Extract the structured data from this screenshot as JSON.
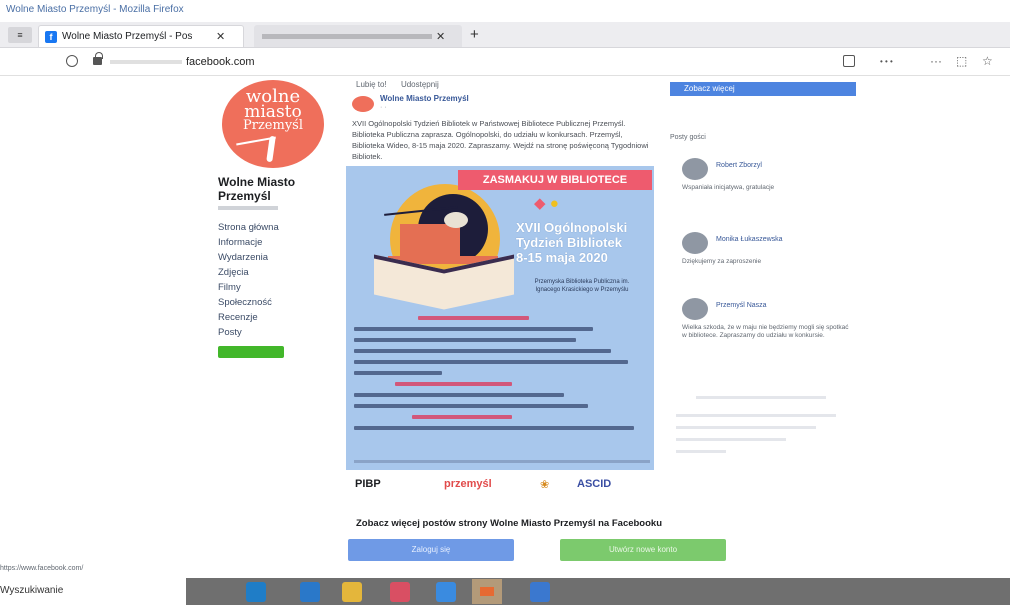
{
  "window": {
    "title": "Wolne Miasto Przemyśl - Mozilla Firefox"
  },
  "tabs": [
    {
      "label": "Wolne Miasto Przemyśl - Pos",
      "close": "✕"
    },
    {
      "label": "",
      "close": "✕"
    }
  ],
  "navbar": {
    "url_host": "facebook.com",
    "more": "···",
    "page_actions": "⋯"
  },
  "page": {
    "logo": {
      "line1": "wolne",
      "line2": "miasto",
      "line3": "Przemyśl"
    },
    "name": "Wolne Miasto Przemyśl",
    "nav": [
      "Strona główna",
      "Informacje",
      "Wydarzenia",
      "Zdjęcia",
      "Filmy",
      "Społeczność",
      "Recenzje",
      "Posty"
    ]
  },
  "post": {
    "tabs": [
      "Lubię to!",
      "Udostępnij"
    ],
    "author": "Wolne Miasto Przemyśl",
    "time": "· ·",
    "text": "XVII Ogólnopolski Tydzień Bibliotek w Państwowej Bibliotece Publicznej Przemyśl. Biblioteka Publiczna zaprasza. Ogólnopolski, do udziału w konkursach. Przemyśl, Biblioteka Wideo, 8-15 maja 2020. Zapraszamy. Wejdź na stronę poświęconą Tygodniowi Bibliotek."
  },
  "poster": {
    "banner": "ZASMAKUJ W BIBLIOTECE",
    "title_line1": "XVII Ogólnopolski",
    "title_line2": "Tydzień Bibliotek",
    "dates": "8-15 maja 2020",
    "org": "Przemyska Biblioteka Publiczna im. Ignacego Krasickiego w Przemyślu"
  },
  "logos": {
    "pizp": "PIBP",
    "mid": "przemyśl",
    "tree": "❀",
    "last": "ASCID"
  },
  "right": {
    "cta": "Zobacz więcej",
    "heading": "Posty gości",
    "entries": [
      {
        "name": "Robert Zborzyl",
        "text": "Wspaniała inicjatywa, gratulacje"
      },
      {
        "name": "Monika Łukaszewska",
        "text": "Dziękujemy za zaproszenie"
      },
      {
        "name": "Przemyśl Nasza",
        "text": "Wielka szkoda, że w maju nie będziemy mogli się spotkać w bibliotece. Zapraszamy do udziału w konkursie."
      }
    ]
  },
  "footer": {
    "more_text": "Zobacz więcej postów strony Wolne Miasto Przemyśl na Facebooku",
    "login": "Zaloguj się",
    "create": "Utwórz nowe konto"
  },
  "status": {
    "url": "https://www.facebook.com/",
    "text": "Wyszukiwanie"
  },
  "taskbar": {
    "items": [
      {
        "icon": "edge-browser-icon",
        "color": "#1f7dc7"
      },
      {
        "icon": "mail-icon",
        "color": "#2a78c9"
      },
      {
        "icon": "folder-icon",
        "color": "#e4b63b"
      },
      {
        "icon": "heart-app-icon",
        "color": "#d94f63"
      },
      {
        "icon": "dropbox-icon",
        "color": "#3a8be0"
      },
      {
        "icon": "firefox-icon",
        "color": "#e66a32"
      },
      {
        "icon": "store-icon",
        "color": "#3b78cf"
      }
    ]
  },
  "colors": {
    "facebook_blue": "#1877f2",
    "logo_coral": "#ef6f5b",
    "poster_bg": "#a8c7ec"
  }
}
